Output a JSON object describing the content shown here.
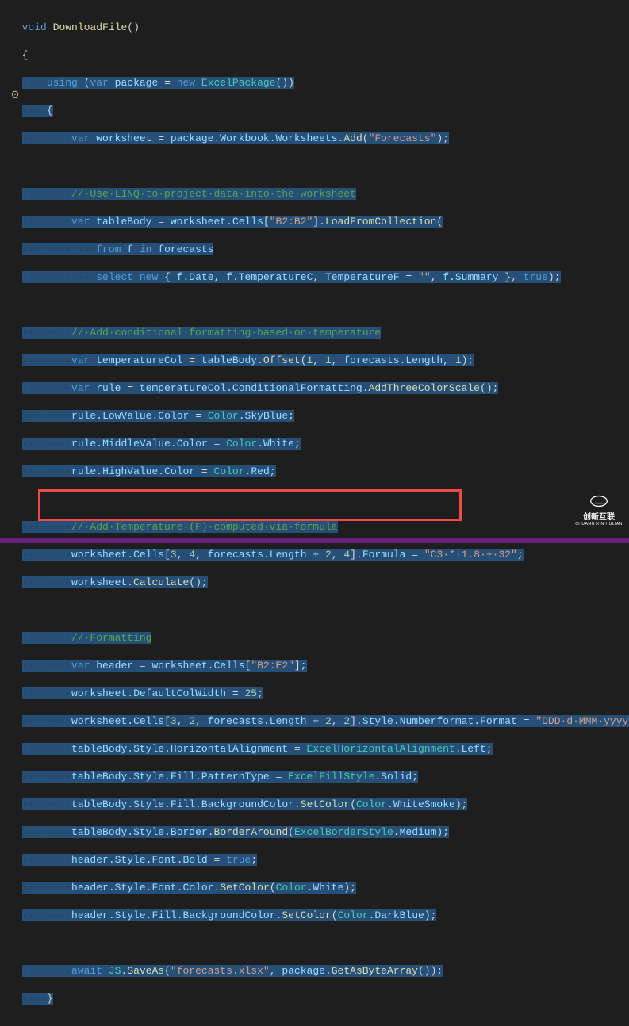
{
  "gutter": {
    "warning_icon": "warning-icon"
  },
  "logo": {
    "text": "创新互联",
    "sub": "CHUANG XIN HULIAN"
  },
  "code": {
    "l1": {
      "kw1": "void",
      "m": "DownloadFile",
      "p": "()"
    },
    "l2": {
      "p": "{"
    },
    "l3": {
      "ws": "····",
      "kw1": "using",
      "p1": " (",
      "kw2": "var",
      "v": " package",
      "p2": " = ",
      "kw3": "new",
      "t": " ExcelPackage",
      "p3": "())"
    },
    "l4": {
      "ws": "····",
      "p": "{"
    },
    "l5": {
      "ws": "········",
      "kw": "var",
      "v1": " worksheet",
      "p1": " = ",
      "v2": "package",
      "p2": ".",
      "v3": "Workbook",
      "p3": ".",
      "v4": "Worksheets",
      "p4": ".",
      "m": "Add",
      "p5": "(",
      "s": "\"Forecasts\"",
      "p6": ");"
    },
    "l6": {
      "ws": ""
    },
    "l7": {
      "ws": "········",
      "c": "//·Use·LINQ·to·project·data·into·the·worksheet"
    },
    "l8": {
      "ws": "········",
      "kw": "var",
      "v1": " tableBody",
      "p1": " = ",
      "v2": "worksheet",
      "p2": ".",
      "v3": "Cells",
      "p3": "[",
      "s": "\"B2:B2\"",
      "p4": "].",
      "m": "LoadFromCollection",
      "p5": "("
    },
    "l9": {
      "ws": "············",
      "kw1": "from",
      "v1": " f ",
      "kw2": "in",
      "v2": " forecasts"
    },
    "l10": {
      "ws": "············",
      "kw1": "select",
      "kw2": " new",
      "p1": " { ",
      "v1": "f",
      "p2": ".",
      "v2": "Date",
      "p3": ", ",
      "v3": "f",
      "p4": ".",
      "v4": "TemperatureC",
      "p5": ", ",
      "v5": "TemperatureF",
      "p6": " = ",
      "s": "\"\"",
      "p7": ", ",
      "v6": "f",
      "p8": ".",
      "v7": "Summary",
      "p9": " }, ",
      "kw3": "true",
      "p10": ");"
    },
    "l11": {
      "ws": ""
    },
    "l12": {
      "ws": "········",
      "c": "//·Add·conditional·formatting·based·on·temperature"
    },
    "l13": {
      "ws": "········",
      "kw": "var",
      "v1": " temperatureCol",
      "p1": " = ",
      "v2": "tableBody",
      "p2": ".",
      "m": "Offset",
      "p3": "(",
      "n1": "1",
      "p4": ", ",
      "n2": "1",
      "p5": ", ",
      "v3": "forecasts",
      "p6": ".",
      "v4": "Length",
      "p7": ", ",
      "n3": "1",
      "p8": ");"
    },
    "l14": {
      "ws": "········",
      "kw": "var",
      "v1": " rule",
      "p1": " = ",
      "v2": "temperatureCol",
      "p2": ".",
      "v3": "ConditionalFormatting",
      "p3": ".",
      "m": "AddThreeColorScale",
      "p4": "();"
    },
    "l15": {
      "ws": "········",
      "v1": "rule",
      "p1": ".",
      "v2": "LowValue",
      "p2": ".",
      "v3": "Color",
      "p3": " = ",
      "t": "Color",
      "p4": ".",
      "v4": "SkyBlue",
      "p5": ";"
    },
    "l16": {
      "ws": "········",
      "v1": "rule",
      "p1": ".",
      "v2": "MiddleValue",
      "p2": ".",
      "v3": "Color",
      "p3": " = ",
      "t": "Color",
      "p4": ".",
      "v4": "White",
      "p5": ";"
    },
    "l17": {
      "ws": "········",
      "v1": "rule",
      "p1": ".",
      "v2": "HighValue",
      "p2": ".",
      "v3": "Color",
      "p3": " = ",
      "t": "Color",
      "p4": ".",
      "v4": "Red",
      "p5": ";"
    },
    "l18": {
      "ws": ""
    },
    "l19": {
      "ws": "········",
      "c": "//·Add·Temperature·(F)·computed·via·formula"
    },
    "l20": {
      "ws": "········",
      "v1": "worksheet",
      "p1": ".",
      "v2": "Cells",
      "p2": "[",
      "n1": "3",
      "p3": ", ",
      "n2": "4",
      "p4": ", ",
      "v3": "forecasts",
      "p5": ".",
      "v4": "Length",
      "p6": " + ",
      "n3": "2",
      "p7": ", ",
      "n4": "4",
      "p8": "].",
      "v5": "Formula",
      "p9": " = ",
      "s": "\"C3·*·1.8·+·32\"",
      "p10": ";"
    },
    "l21": {
      "ws": "········",
      "v1": "worksheet",
      "p1": ".",
      "m": "Calculate",
      "p2": "();"
    },
    "l22": {
      "ws": ""
    },
    "l23": {
      "ws": "········",
      "c": "//·Formatting"
    },
    "l24": {
      "ws": "········",
      "kw": "var",
      "v1": " header",
      "p1": " = ",
      "v2": "worksheet",
      "p2": ".",
      "v3": "Cells",
      "p3": "[",
      "s": "\"B2:E2\"",
      "p4": "];"
    },
    "l25": {
      "ws": "········",
      "v1": "worksheet",
      "p1": ".",
      "v2": "DefaultColWidth",
      "p2": " = ",
      "n": "25",
      "p3": ";"
    },
    "l26": {
      "ws": "········",
      "v1": "worksheet",
      "p1": ".",
      "v2": "Cells",
      "p2": "[",
      "n1": "3",
      "p3": ", ",
      "n2": "2",
      "p4": ", ",
      "v3": "forecasts",
      "p5": ".",
      "v4": "Length",
      "p6": " + ",
      "n3": "2",
      "p7": ", ",
      "n4": "2",
      "p8": "].",
      "v5": "Style",
      "p9": ".",
      "v6": "Numberformat",
      "p10": ".",
      "v7": "Format",
      "p11": " = ",
      "s": "\"DDD·d·MMM·yyyy\"",
      "p12": ";"
    },
    "l27": {
      "ws": "········",
      "v1": "tableBody",
      "p1": ".",
      "v2": "Style",
      "p2": ".",
      "v3": "HorizontalAlignment",
      "p3": " = ",
      "t": "ExcelHorizontalAlignment",
      "p4": ".",
      "v4": "Left",
      "p5": ";"
    },
    "l28": {
      "ws": "········",
      "v1": "tableBody",
      "p1": ".",
      "v2": "Style",
      "p2": ".",
      "v3": "Fill",
      "p3": ".",
      "v4": "PatternType",
      "p4": " = ",
      "t": "ExcelFillStyle",
      "p5": ".",
      "v5": "Solid",
      "p6": ";"
    },
    "l29": {
      "ws": "········",
      "v1": "tableBody",
      "p1": ".",
      "v2": "Style",
      "p2": ".",
      "v3": "Fill",
      "p3": ".",
      "v4": "BackgroundColor",
      "p4": ".",
      "m": "SetColor",
      "p5": "(",
      "t": "Color",
      "p6": ".",
      "v5": "WhiteSmoke",
      "p7": ");"
    },
    "l30": {
      "ws": "········",
      "v1": "tableBody",
      "p1": ".",
      "v2": "Style",
      "p2": ".",
      "v3": "Border",
      "p3": ".",
      "m": "BorderAround",
      "p4": "(",
      "t": "ExcelBorderStyle",
      "p5": ".",
      "v4": "Medium",
      "p6": ");"
    },
    "l31": {
      "ws": "········",
      "v1": "header",
      "p1": ".",
      "v2": "Style",
      "p2": ".",
      "v3": "Font",
      "p3": ".",
      "v4": "Bold",
      "p4": " = ",
      "kw": "true",
      "p5": ";"
    },
    "l32": {
      "ws": "········",
      "v1": "header",
      "p1": ".",
      "v2": "Style",
      "p2": ".",
      "v3": "Font",
      "p3": ".",
      "v4": "Color",
      "p4": ".",
      "m": "SetColor",
      "p5": "(",
      "t": "Color",
      "p6": ".",
      "v5": "White",
      "p7": ");"
    },
    "l33": {
      "ws": "········",
      "v1": "header",
      "p1": ".",
      "v2": "Style",
      "p2": ".",
      "v3": "Fill",
      "p3": ".",
      "v4": "BackgroundColor",
      "p4": ".",
      "m": "SetColor",
      "p5": "(",
      "t": "Color",
      "p6": ".",
      "v5": "DarkBlue",
      "p7": ");"
    },
    "l34": {
      "ws": ""
    },
    "l35": {
      "ws": "········",
      "kw": "await",
      "t": " JS",
      "p1": ".",
      "m": "SaveAs",
      "p2": "(",
      "s": "\"forecasts.xlsx\"",
      "p3": ", ",
      "v1": "package",
      "p4": ".",
      "m2": "GetAsByteArray",
      "p5": "());"
    },
    "l36": {
      "ws": "····",
      "p": "}"
    }
  }
}
